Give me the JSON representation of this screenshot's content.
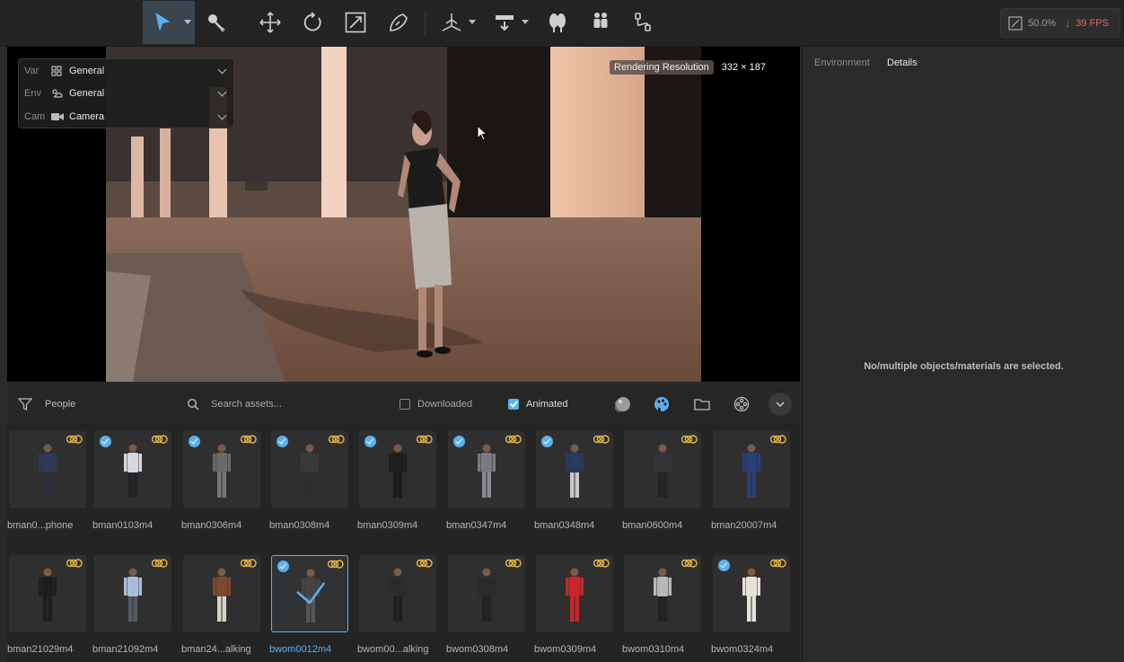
{
  "toolbar": {
    "tools": [
      {
        "name": "select",
        "icon": "cursor-arrow-icon",
        "active": true,
        "dropdown": true
      },
      {
        "name": "material-picker",
        "icon": "eyedropper-icon"
      },
      {
        "name": "move",
        "icon": "move-icon"
      },
      {
        "name": "rotate",
        "icon": "rotate-icon"
      },
      {
        "name": "scale",
        "icon": "scale-icon"
      },
      {
        "name": "paint",
        "icon": "paint-icon"
      },
      {
        "name": "place-object",
        "icon": "place-object-icon",
        "dropdown": true
      },
      {
        "name": "path-tool",
        "icon": "path-tool-icon",
        "dropdown": true
      },
      {
        "name": "vegetation",
        "icon": "trees-icon"
      },
      {
        "name": "people",
        "icon": "people-icon"
      },
      {
        "name": "measure",
        "icon": "measure-icon"
      }
    ],
    "perf": {
      "zoom": "50.0%",
      "fps": "39 FPS"
    }
  },
  "viewport": {
    "overlay": [
      {
        "key": "Var",
        "value": "General",
        "icon": "variation-icon"
      },
      {
        "key": "Env",
        "value": "General",
        "icon": "environment-icon"
      },
      {
        "key": "Cam",
        "value": "Camera",
        "icon": "camera-icon"
      }
    ],
    "resolution_label": "Rendering Resolution",
    "resolution_value": "332 × 187"
  },
  "right_panel": {
    "tabs": [
      "Environment",
      "Details"
    ],
    "active_tab": "Details",
    "message": "No/multiple objects/materials are selected."
  },
  "asset_bar": {
    "category": "People",
    "search_placeholder": "Search assets...",
    "downloaded_label": "Downloaded",
    "downloaded_checked": false,
    "animated_label": "Animated",
    "animated_checked": true
  },
  "assets": [
    {
      "name": "bman0...phone",
      "downloaded": false,
      "outfit": "#2d3a55",
      "pants": "#2a2f40"
    },
    {
      "name": "bman0103m4",
      "downloaded": true,
      "outfit": "#d8d8de",
      "pants": "#222222"
    },
    {
      "name": "bman0306m4",
      "downloaded": true,
      "outfit": "#6a6a6a",
      "pants": "#777777"
    },
    {
      "name": "bman0308m4",
      "downloaded": true,
      "outfit": "#3a3a3a",
      "pants": "#2e2e2e"
    },
    {
      "name": "bman0309m4",
      "downloaded": true,
      "outfit": "#1e1e1e",
      "pants": "#1a1a1a"
    },
    {
      "name": "bman0347m4",
      "downloaded": true,
      "outfit": "#7a7a80",
      "pants": "#8a8a90"
    },
    {
      "name": "bman0348m4",
      "downloaded": true,
      "outfit": "#283a60",
      "pants": "#c8c8c8"
    },
    {
      "name": "bman0600m4",
      "downloaded": false,
      "outfit": "#333338",
      "pants": "#222"
    },
    {
      "name": "bman20007m4",
      "downloaded": false,
      "outfit": "#2a3e78",
      "pants": "#2a3e78"
    },
    {
      "name": "bman21029m4",
      "downloaded": false,
      "outfit": "#1d1d1d",
      "pants": "#1d1d1d"
    },
    {
      "name": "bman21092m4",
      "downloaded": false,
      "outfit": "#a9bfd9",
      "pants": "#555a66"
    },
    {
      "name": "bman24...alking",
      "downloaded": false,
      "outfit": "#7a4a30",
      "pants": "#d8d2c4"
    },
    {
      "name": "bwom0012m4",
      "downloaded": true,
      "selected": true,
      "outfit": "#444",
      "pants": "#555"
    },
    {
      "name": "bwom00...alking",
      "downloaded": false,
      "outfit": "#2b2b2b",
      "pants": "#1e1e1e"
    },
    {
      "name": "bwom0308m4",
      "downloaded": false,
      "outfit": "#2a2a2a",
      "pants": "#222"
    },
    {
      "name": "bwom0309m4",
      "downloaded": false,
      "outfit": "#c8262a",
      "pants": "#c8262a"
    },
    {
      "name": "bwom0310m4",
      "downloaded": false,
      "outfit": "#b8b8b8",
      "pants": "#222"
    },
    {
      "name": "bwom0324m4",
      "downloaded": true,
      "outfit": "#e6e2da",
      "pants": "#e6e2da"
    }
  ],
  "colors": {
    "accent": "#5cb0f0",
    "fps_warning": "#e06a5a",
    "animated_badge": "#e8b84a"
  }
}
